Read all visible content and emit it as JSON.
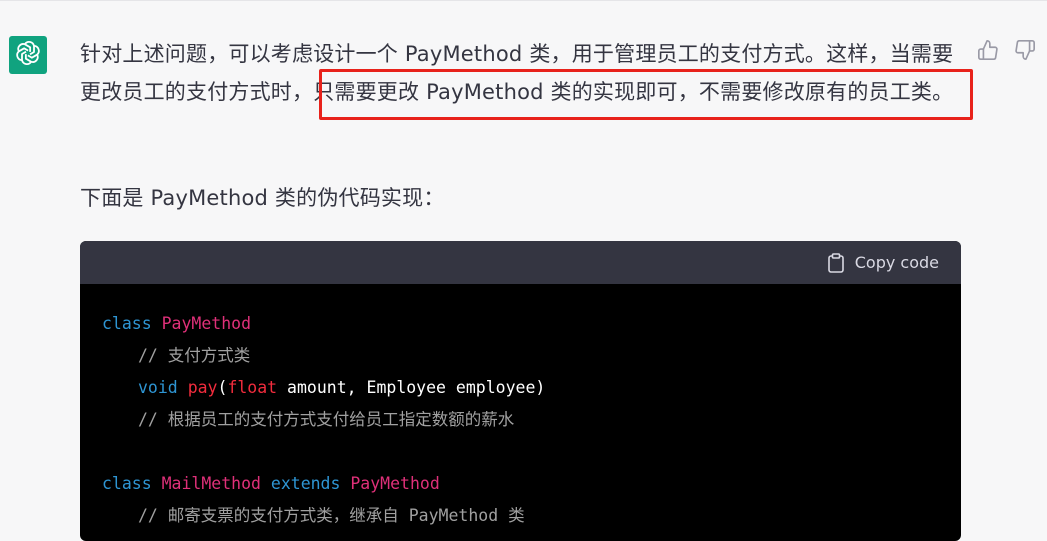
{
  "message": {
    "paragraph1": "针对上述问题，可以考虑设计一个 PayMethod 类，用于管理员工的支付方式。这样，当需要更改员工的支付方式时，只需要更改 PayMethod 类的实现即可，不需要修改原有的员工类。",
    "paragraph2": "下面是 PayMethod 类的伪代码实现："
  },
  "codeblock": {
    "copy_label": "Copy code",
    "lines": [
      {
        "kw": "class",
        "cls": "PayMethod"
      },
      {
        "comment": "// 支付方式类"
      },
      {
        "kw": "void",
        "fn": "pay",
        "open": "(",
        "ptype": "float",
        "params": " amount, Employee employee)"
      },
      {
        "comment": "// 根据员工的支付方式支付给员工指定数额的薪水"
      },
      {
        "kw": "class",
        "cls": "MailMethod",
        "kw2": "extends",
        "cls2": "PayMethod"
      },
      {
        "comment": "// 邮寄支票的支付方式类，继承自 PayMethod 类"
      }
    ]
  },
  "icons": {
    "avatar": "chatgpt-logo-icon",
    "like": "thumbs-up-icon",
    "dislike": "thumbs-down-icon",
    "copy": "clipboard-icon"
  },
  "colors": {
    "avatar_bg": "#10a37f",
    "highlight_border": "#e8221b",
    "code_header_bg": "#343541",
    "code_bg": "#000000"
  }
}
